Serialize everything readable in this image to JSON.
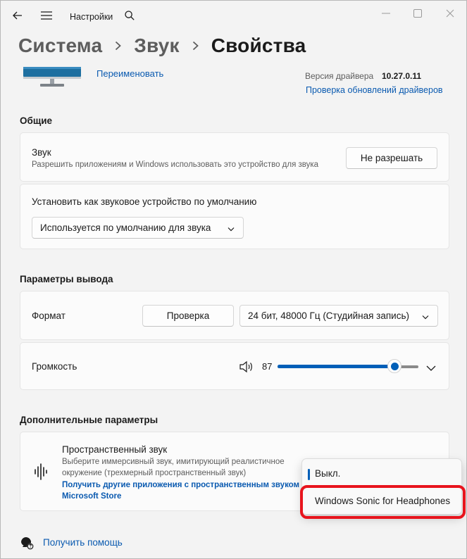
{
  "titlebar": {
    "title": "Настройки"
  },
  "breadcrumb": {
    "items": [
      "Система",
      "Звук"
    ],
    "current": "Свойства"
  },
  "device": {
    "rename": "Переименовать",
    "driver_label": "Версия драйвера",
    "driver_version": "10.27.0.11",
    "driver_update": "Проверка обновлений драйверов"
  },
  "general": {
    "title": "Общие",
    "sound_title": "Звук",
    "sound_sub": "Разрешить приложениям и Windows использовать это устройство для звука",
    "sound_button": "Не разрешать",
    "default_title": "Установить как звуковое устройство по умолчанию",
    "default_combo": "Используется по умолчанию для звука"
  },
  "output": {
    "title": "Параметры вывода",
    "format_label": "Формат",
    "test_button": "Проверка",
    "format_combo": "24 бит, 48000 Гц (Студийная запись)",
    "volume_label": "Громкость",
    "volume_value": "87",
    "volume_level": 0.87
  },
  "advanced": {
    "title": "Дополнительные параметры",
    "spatial_title": "Пространственный звук",
    "spatial_sub_1": "Выберите иммерсивный звук, имитирующий реалистичное",
    "spatial_sub_2": "окружение (трехмерный пространственный звук)",
    "spatial_link_1": "Получить другие приложения с пространственным звуком из",
    "spatial_link_2": "Microsoft Store"
  },
  "popup": {
    "options": [
      "Выкл.",
      "Windows Sonic for Headphones"
    ],
    "selected": "Выкл."
  },
  "footer": {
    "help": "Получить помощь"
  },
  "colors": {
    "accent": "#005fb8",
    "link": "#0a5ab0",
    "highlight": "#e8141d"
  }
}
